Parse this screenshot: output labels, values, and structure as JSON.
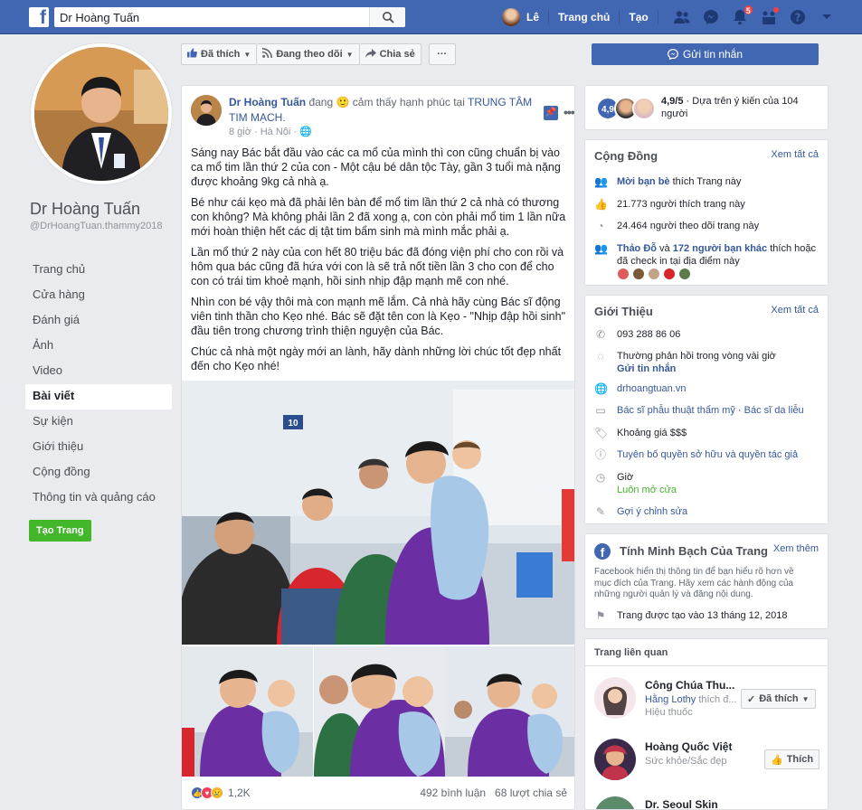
{
  "topbar": {
    "logo": "f",
    "search_value": "Dr Hoàng Tuấn",
    "user_name": "Lê",
    "home": "Trang chủ",
    "create": "Tạo",
    "notif_count": "5"
  },
  "profile": {
    "name": "Dr Hoàng Tuấn",
    "handle": "@DrHoangTuan.thammy2018"
  },
  "left_nav": {
    "items": [
      "Trang chủ",
      "Cửa hàng",
      "Đánh giá",
      "Ảnh",
      "Video",
      "Bài viết",
      "Sự kiện",
      "Giới thiệu",
      "Cộng đồng",
      "Thông tin và quảng cáo"
    ],
    "active_index": 5,
    "create_page": "Tạo Trang"
  },
  "actions": {
    "like": "Đã thích",
    "follow": "Đang theo dõi",
    "share": "Chia sẻ",
    "more": "···",
    "send_message": "Gửi tin nhắn"
  },
  "post": {
    "author": "Dr Hoàng Tuấn",
    "feeling_prefix": "đang",
    "feeling": "cảm thấy hạnh phúc tại",
    "location": "TRUNG TÂM TIM MẠCH.",
    "time": "8 giờ",
    "place": "Hà Nội",
    "paragraphs": [
      "Sáng nay Bác bắt đầu vào các ca mổ của mình thì con cũng chuẩn bị vào ca mổ tim lần thứ 2 của con - Một cậu bé dân tộc Tày, gần 3 tuổi mà nặng được khoảng 9kg cả nhà ạ.",
      "Bé như cái kẹo mà đã phải lên bàn để mổ tim lần thứ 2 cả nhà có thương con không? Mà không phải lần 2 đã xong ạ, con còn phải mổ tim 1 lần nữa mới hoàn thiện hết các dị tật tim bẩm sinh mà mình mắc phải ạ.",
      "Lần mổ thứ 2 này của con hết 80 triệu bác đã đóng viện phí cho con rồi và hôm qua bác cũng đã hứa với con là sẽ trả nốt tiền lần 3 cho con để cho con có trái tim khoẻ mạnh, hồi sinh nhịp đập mạnh mẽ con nhé.",
      "Nhìn con bé vậy thôi mà con mạnh mẽ lắm. Cả nhà hãy cùng Bác sĩ động viên tinh thần cho Kẹo nhé. Bác sẽ đặt tên con là Kẹo - \"Nhịp đập hồi sinh\" đầu tiên trong chương trình thiện nguyện của Bác.",
      "Chúc cả nhà một ngày mới an lành, hãy dành những lời chúc tốt đẹp nhất đến cho Kẹo nhé!"
    ],
    "room_number": "10",
    "reactions": "1,2K",
    "comments": "492 bình luận",
    "shares": "68 lượt chia sẻ"
  },
  "rating": {
    "score": "4,9",
    "text_score": "4,9/5",
    "text": " · Dựa trên ý kiến của 104 người"
  },
  "community": {
    "title": "Cộng Đồng",
    "see_all": "Xem tất cả",
    "invite_link": "Mời bạn bè",
    "invite_text": " thích Trang này",
    "likes": "21.773 người thích trang này",
    "follows": "24.464 người theo dõi trang này",
    "friend1": "Thảo Đỗ",
    "friend_and": " và ",
    "friend_others": "172 người bạn khác",
    "friend_text": " thích hoặc đã check in tại địa điểm này"
  },
  "about": {
    "title": "Giới Thiệu",
    "see_all": "Xem tất cả",
    "phone": "093 288 86 06",
    "response": "Thường phản hồi trong vòng vài giờ",
    "send_message": "Gửi tin nhắn",
    "website": "drhoangtuan.vn",
    "category1": "Bác sĩ phẫu thuật thẩm mỹ",
    "category_sep": " · ",
    "category2": "Bác sĩ da liễu",
    "price": "Khoảng giá $$$",
    "copyright": "Tuyên bố quyền sở hữu và quyền tác giả",
    "hours_label": "Giờ",
    "hours_value": "Luôn mở cửa",
    "suggest": "Gợi ý chỉnh sửa"
  },
  "transparency": {
    "title": "Tính Minh Bạch Của Trang",
    "see_more": "Xem thêm",
    "desc": "Facebook hiển thị thông tin để bạn hiểu rõ hơn về mục đích của Trang. Hãy xem các hành động của những người quản lý và đăng nội dung.",
    "created": "Trang được tạo vào 13 tháng 12, 2018"
  },
  "related": {
    "title": "Trang liên quan",
    "items": [
      {
        "name": "Công Chúa Thu...",
        "liker": "Hằng Lothy",
        "liker_text": " thích đ...",
        "sub": "Hiệu thuốc",
        "button": "Đã thích"
      },
      {
        "name": "Hoàng Quốc Việt",
        "sub": "Sức khỏe/Sắc đẹp",
        "button": "Thích"
      },
      {
        "name": "Dr. Seoul Skin"
      }
    ]
  },
  "colors": {
    "brand": "#4267b2",
    "link": "#365899",
    "green": "#42b72a",
    "background": "#e9ebee"
  }
}
